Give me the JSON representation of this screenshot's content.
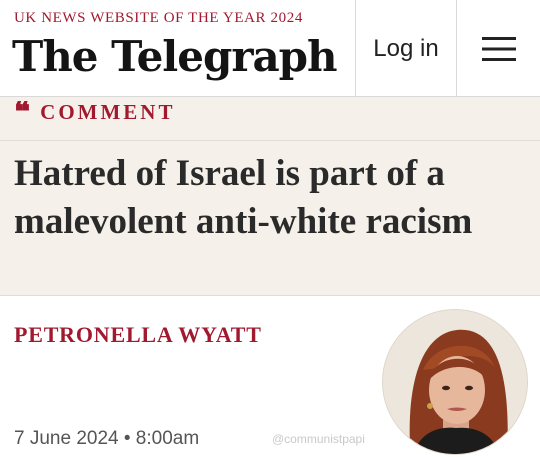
{
  "header": {
    "award": "UK NEWS WEBSITE OF THE YEAR 2024",
    "masthead": "The Telegraph",
    "login_label": "Log in",
    "menu_icon": "hamburger-menu-icon"
  },
  "article": {
    "section_icon": "quote-mark-icon",
    "section_icon_glyph": "❝",
    "section": "COMMENT",
    "headline": "Hatred of Israel is part of a malevolent anti-white racism",
    "author": "PETRONELLA WYATT",
    "date": "7 June 2024 • 8:00am",
    "author_photo": "author-portrait"
  },
  "overlay": {
    "watermark": "@communistpapi"
  },
  "colors": {
    "accent": "#a1192f",
    "band": "#f5f1ea",
    "masthead": "#141414",
    "text": "#2a2a2a"
  }
}
